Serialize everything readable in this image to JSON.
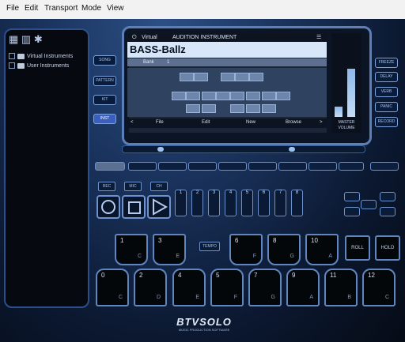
{
  "menu": [
    "File",
    "Edit",
    "Transport",
    "Mode",
    "View"
  ],
  "sidebar": {
    "items": [
      {
        "label": "Virtual Instruments"
      },
      {
        "label": "User Instruments"
      }
    ]
  },
  "left_buttons": [
    "SONG",
    "PATTERN",
    "KIT",
    "INST"
  ],
  "right_buttons": [
    "FREEZE",
    "DELAY",
    "VERB",
    "PANIC",
    "RECORD"
  ],
  "screen": {
    "header_mode": "Virtual",
    "header_title": "AUDITION INSTRUMENT",
    "instrument_name": "BASS-Ballz",
    "bank_label": "Bank",
    "bank_value": "1",
    "bottom_menu": [
      "<",
      "File",
      "Edit",
      "New",
      "Browse",
      ">"
    ],
    "master_label": "MASTER",
    "volume_label": "VOLUME"
  },
  "levels": {
    "meter_left": 0.15,
    "meter_right": 0.68
  },
  "tracks": [
    "1",
    "2",
    "3",
    "4",
    "5",
    "6",
    "7",
    "8"
  ],
  "small_buttons": [
    "REC",
    "MIC",
    "CH"
  ],
  "pads": {
    "top": [
      {
        "num": "1",
        "note": "C"
      },
      {
        "num": "3",
        "note": "E"
      },
      {
        "num": "6",
        "note": "F"
      },
      {
        "num": "8",
        "note": "G"
      },
      {
        "num": "10",
        "note": "A"
      }
    ],
    "bottom": [
      {
        "num": "0",
        "note": "C"
      },
      {
        "num": "2",
        "note": "D"
      },
      {
        "num": "4",
        "note": "E"
      },
      {
        "num": "5",
        "note": "F"
      },
      {
        "num": "7",
        "note": "G"
      },
      {
        "num": "9",
        "note": "A"
      },
      {
        "num": "11",
        "note": "B"
      },
      {
        "num": "12",
        "note": "C"
      }
    ],
    "tempo_label": "TEMPO",
    "roll_label": "ROLL",
    "hold_label": "HOLD"
  },
  "logo": {
    "brand": "BTVSOLO",
    "tagline": "MUSIC PRODUCTION SOFTWARE"
  },
  "colors": {
    "accent": "#5c7fb8",
    "screen_highlight": "#d7e6f9",
    "background": "#1a335d"
  }
}
